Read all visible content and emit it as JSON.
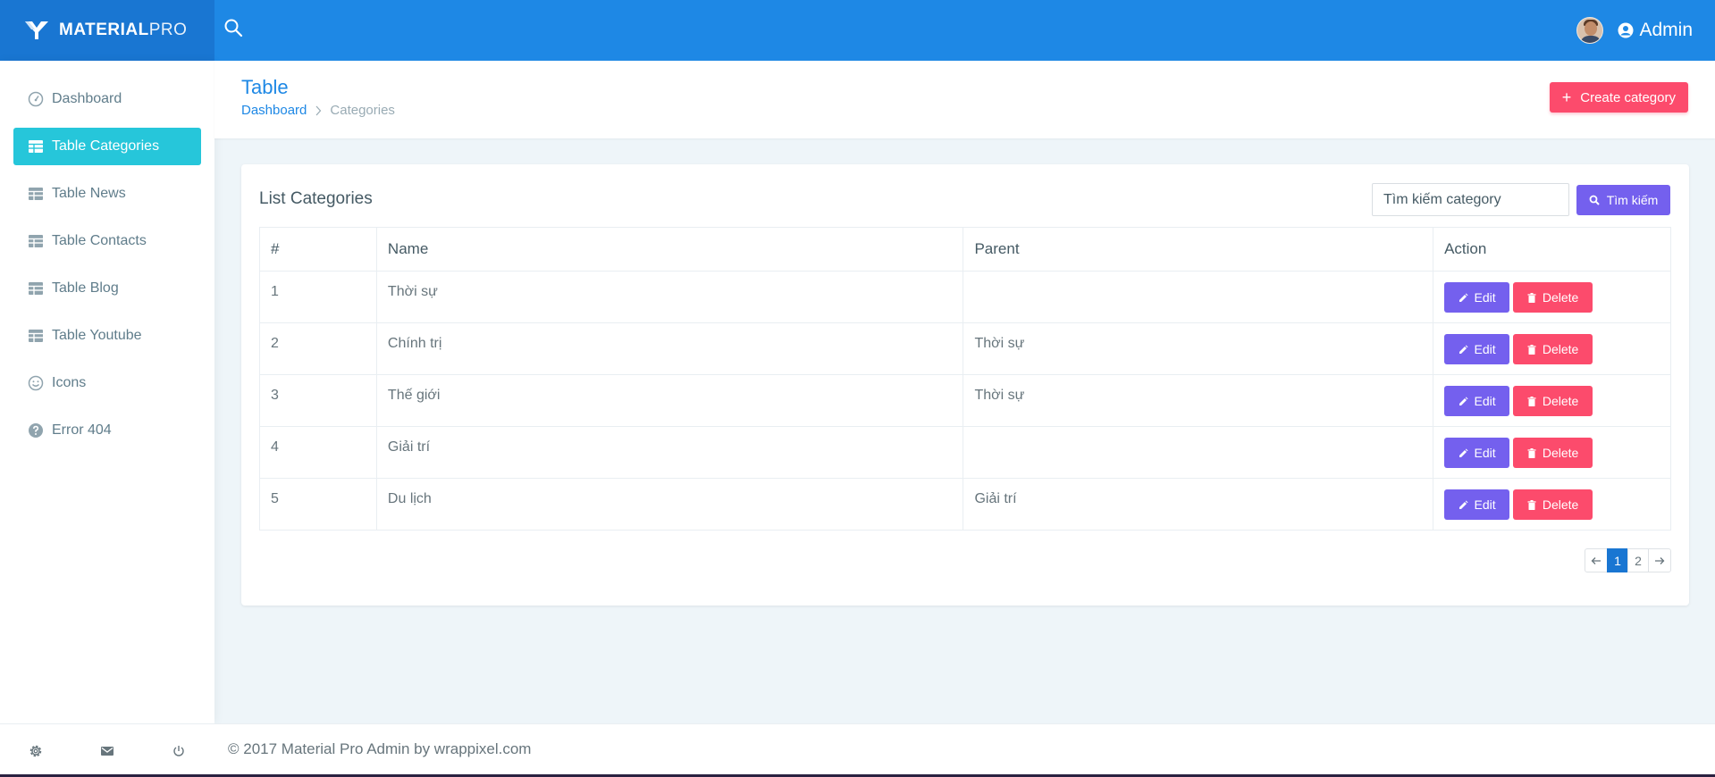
{
  "brand": {
    "bold": "MATERIAL",
    "light": "PRO"
  },
  "topbar": {
    "user_name": "Admin"
  },
  "sidebar": {
    "items": [
      {
        "label": "Dashboard",
        "icon": "dashboard-icon",
        "active": false
      },
      {
        "label": "Table Categories",
        "icon": "table-icon",
        "active": true
      },
      {
        "label": "Table News",
        "icon": "table-icon",
        "active": false
      },
      {
        "label": "Table Contacts",
        "icon": "table-icon",
        "active": false
      },
      {
        "label": "Table Blog",
        "icon": "table-icon",
        "active": false
      },
      {
        "label": "Table Youtube",
        "icon": "table-icon",
        "active": false
      },
      {
        "label": "Icons",
        "icon": "smile-icon",
        "active": false
      },
      {
        "label": "Error 404",
        "icon": "help-icon",
        "active": false
      }
    ],
    "footer_icons": [
      "gear-icon",
      "mail-icon",
      "power-icon"
    ]
  },
  "page": {
    "title": "Table",
    "breadcrumb": {
      "home": "Dashboard",
      "current": "Categories"
    },
    "create_button": "Create category"
  },
  "card": {
    "title": "List Categories",
    "search_placeholder": "Tìm kiếm category",
    "search_button": "Tìm kiếm",
    "columns": [
      "#",
      "Name",
      "Parent",
      "Action"
    ],
    "rows": [
      {
        "id": "1",
        "name": "Thời sự",
        "parent": ""
      },
      {
        "id": "2",
        "name": "Chính trị",
        "parent": "Thời sự"
      },
      {
        "id": "3",
        "name": "Thế giới",
        "parent": "Thời sự"
      },
      {
        "id": "4",
        "name": "Giải trí",
        "parent": ""
      },
      {
        "id": "5",
        "name": "Du lịch",
        "parent": "Giải trí"
      }
    ],
    "edit_label": "Edit",
    "delete_label": "Delete",
    "pagination": {
      "pages": [
        "1",
        "2"
      ],
      "current": "1"
    }
  },
  "footer": {
    "text": "© 2017 Material Pro Admin by wrappixel.com"
  },
  "colors": {
    "topbar": "#1e88e5",
    "brand_bg": "#1976d2",
    "active_nav": "#26c6da",
    "edit": "#7460ee",
    "delete": "#fc4b6c"
  }
}
